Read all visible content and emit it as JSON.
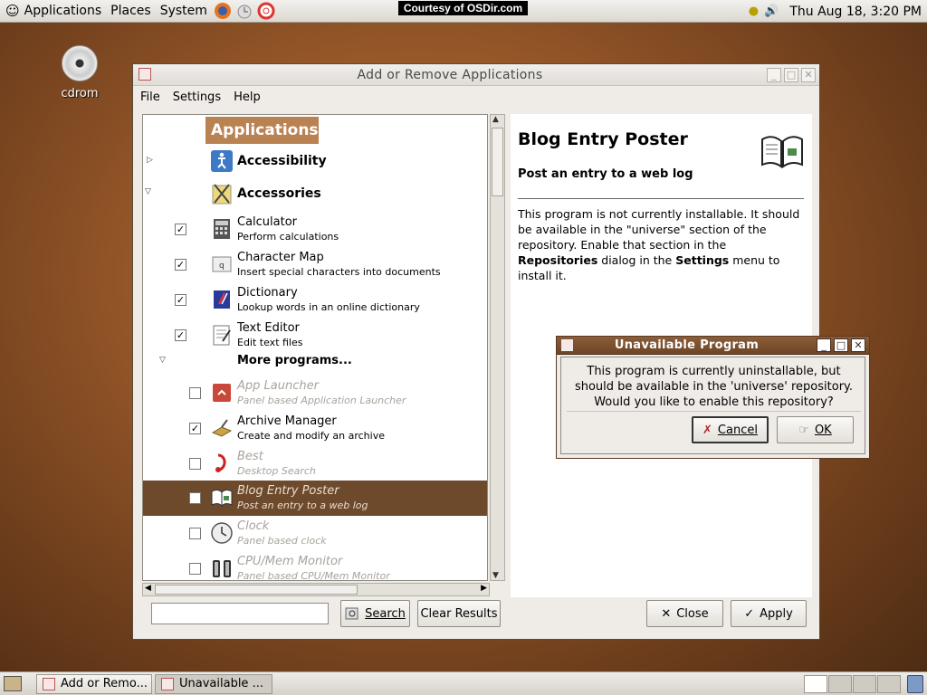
{
  "top_panel": {
    "menus": [
      "Applications",
      "Places",
      "System"
    ],
    "banner": "Courtesy of OSDir.com",
    "clock": "Thu Aug 18,  3:20 PM"
  },
  "desktop": {
    "icons": [
      {
        "label": "cdrom"
      }
    ]
  },
  "main_window": {
    "title": "Add or Remove Applications",
    "menu": [
      {
        "label": "File",
        "mnemonic": "F"
      },
      {
        "label": "Settings",
        "mnemonic": "S"
      },
      {
        "label": "Help",
        "mnemonic": "H"
      }
    ],
    "tree": {
      "header": "Applications",
      "categories": [
        {
          "name": "Accessibility",
          "expanded": false,
          "icon": "accessibility-icon"
        },
        {
          "name": "Accessories",
          "expanded": true,
          "icon": "accessories-icon"
        }
      ],
      "accessories": [
        {
          "name": "Calculator",
          "desc": "Perform calculations",
          "checked": true,
          "icon": "calculator-icon"
        },
        {
          "name": "Character Map",
          "desc": "Insert special characters into documents",
          "checked": true,
          "icon": "character-map-icon"
        },
        {
          "name": "Dictionary",
          "desc": "Lookup words in an online dictionary",
          "checked": true,
          "icon": "dictionary-icon"
        },
        {
          "name": "Text Editor",
          "desc": "Edit text files",
          "checked": true,
          "icon": "text-editor-icon"
        }
      ],
      "more_programs": "More programs...",
      "more": [
        {
          "name": "App Launcher",
          "desc": "Panel based Application Launcher",
          "checked": false,
          "dim": true,
          "icon": "app-launcher-icon"
        },
        {
          "name": "Archive Manager",
          "desc": "Create and modify an archive",
          "checked": true,
          "dim": false,
          "icon": "archive-manager-icon"
        },
        {
          "name": "Best",
          "desc": "Desktop Search",
          "checked": false,
          "dim": true,
          "icon": "best-icon"
        },
        {
          "name": "Blog Entry Poster",
          "desc": "Post an entry to a web log",
          "checked": false,
          "dim": true,
          "selected": true,
          "icon": "blog-poster-icon"
        },
        {
          "name": "Clock",
          "desc": "Panel based clock",
          "checked": false,
          "dim": true,
          "icon": "clock-icon"
        },
        {
          "name": "CPU/Mem Monitor",
          "desc": "Panel based CPU/Mem Monitor",
          "checked": false,
          "dim": true,
          "icon": "cpu-monitor-icon"
        }
      ]
    },
    "description": {
      "title": "Blog Entry Poster",
      "subtitle": "Post an entry to a web log",
      "body_1": "This program is not currently installable. It should be available in the \"universe\" section of the repository. Enable that section in the ",
      "bold_1": "Repositories",
      "body_2": " dialog in the ",
      "bold_2": "Settings",
      "body_3": " menu to install it."
    },
    "search": {
      "value": "",
      "button": "Search",
      "clear": "Clear Results"
    },
    "buttons": {
      "close": "Close",
      "apply": "Apply"
    }
  },
  "dialog": {
    "title": "Unavailable Program",
    "message": "This program is currently uninstallable, but should be available in the 'universe' repository. Would you like to enable this repository?",
    "cancel": "Cancel",
    "ok": "OK"
  },
  "taskbar": {
    "tasks": [
      "Add or Remo...",
      "Unavailable ..."
    ]
  }
}
